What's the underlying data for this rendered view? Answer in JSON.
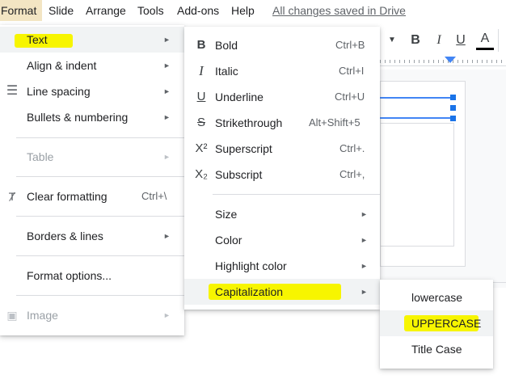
{
  "menubar": {
    "items": [
      {
        "label": "Format"
      },
      {
        "label": "Slide"
      },
      {
        "label": "Arrange"
      },
      {
        "label": "Tools"
      },
      {
        "label": "Add-ons"
      },
      {
        "label": "Help"
      }
    ],
    "saved_status": "All changes saved in Drive"
  },
  "toolbar": {
    "dropdown_icon": "caret-down-icon",
    "bold": "B",
    "italic": "I",
    "underline": "U",
    "text_color": "A"
  },
  "format_menu": {
    "items": [
      {
        "label": "Text",
        "submenu": true,
        "icon": ""
      },
      {
        "label": "Align & indent",
        "submenu": true
      },
      {
        "label": "Line spacing",
        "submenu": true,
        "icon": "line-spacing-icon"
      },
      {
        "label": "Bullets & numbering",
        "submenu": true
      },
      {
        "label": "Table",
        "submenu": true,
        "disabled": true
      },
      {
        "label": "Clear formatting",
        "shortcut": "Ctrl+\\",
        "icon": "clear-formatting-icon"
      },
      {
        "label": "Borders & lines",
        "submenu": true
      },
      {
        "label": "Format options..."
      },
      {
        "label": "Image",
        "submenu": true,
        "disabled": true,
        "icon": "image-icon"
      }
    ]
  },
  "text_menu": {
    "items": [
      {
        "label": "Bold",
        "shortcut": "Ctrl+B",
        "icon": "bold-icon"
      },
      {
        "label": "Italic",
        "shortcut": "Ctrl+I",
        "icon": "italic-icon"
      },
      {
        "label": "Underline",
        "shortcut": "Ctrl+U",
        "icon": "underline-icon"
      },
      {
        "label": "Strikethrough",
        "shortcut": "Alt+Shift+5",
        "icon": "strikethrough-icon"
      },
      {
        "label": "Superscript",
        "shortcut": "Ctrl+.",
        "icon": "superscript-icon"
      },
      {
        "label": "Subscript",
        "shortcut": "Ctrl+,",
        "icon": "subscript-icon"
      },
      {
        "label": "Size",
        "submenu": true
      },
      {
        "label": "Color",
        "submenu": true
      },
      {
        "label": "Highlight color",
        "submenu": true
      },
      {
        "label": "Capitalization",
        "submenu": true
      }
    ]
  },
  "capitalization_menu": {
    "items": [
      {
        "label": "lowercase"
      },
      {
        "label": "UPPERCASE"
      },
      {
        "label": "Title Case"
      }
    ]
  },
  "colors": {
    "highlighter": "#f7f500",
    "selection": "#4285f4",
    "active_menu": "#f3e5c3"
  }
}
